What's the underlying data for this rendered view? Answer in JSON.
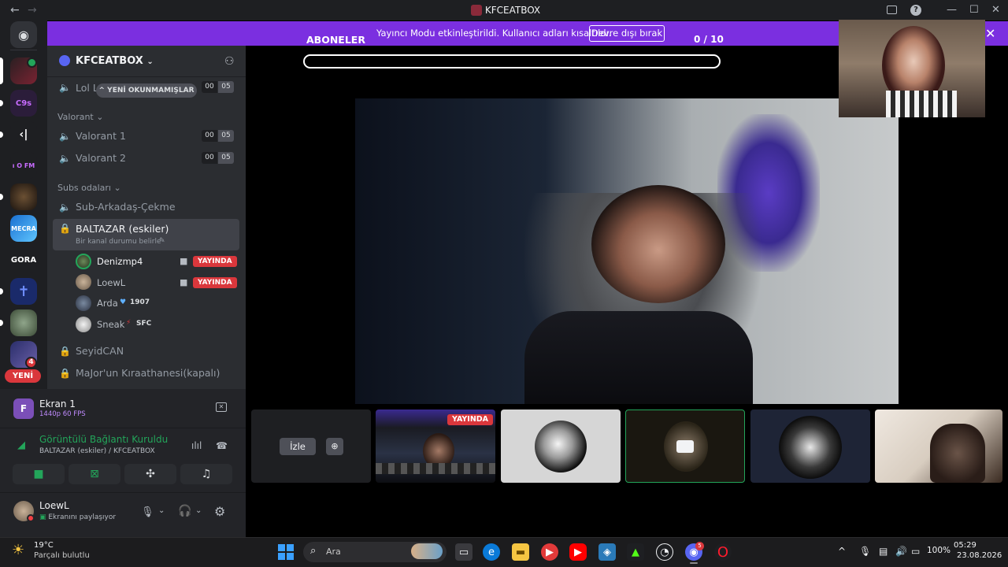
{
  "titlebar": {
    "title": "KFCEATBOX",
    "back": "←",
    "forward": "→",
    "inbox_icon": "inbox-icon",
    "help": "?",
    "minimize": "—",
    "maximize": "☐",
    "close": "✕"
  },
  "rail": {
    "servers": [
      {
        "name": "discord-home",
        "label": "◉"
      },
      {
        "name": "kfceatbox",
        "label": ""
      },
      {
        "name": "c9s",
        "label": "C9s"
      },
      {
        "name": "k-logo",
        "label": "‹|"
      },
      {
        "name": "ufm",
        "label": "ı O FM"
      },
      {
        "name": "dark-server",
        "label": ""
      },
      {
        "name": "mecra",
        "label": "MECRA"
      },
      {
        "name": "gora",
        "label": "GORA"
      },
      {
        "name": "cross-server",
        "label": "✝"
      },
      {
        "name": "green-server",
        "label": ""
      },
      {
        "name": "purple-server",
        "label": ""
      }
    ],
    "notification_count": "4",
    "yeni_label": "YENİ"
  },
  "streamer_bar": {
    "message": "Yayıncı Modu etkinleştirildi. Kullanıcı adları kısaltıldı.",
    "disable_button": "Devre dışı bırak",
    "close": "✕"
  },
  "sidebar": {
    "server_name": "KFCEATBOX",
    "unread_pill": "YENİ OKUNMAMIŞLAR",
    "top_channel": {
      "name": "Lol L",
      "count_a": "00",
      "count_b": "05"
    },
    "categories": [
      {
        "name": "Valorant",
        "channels": [
          {
            "name": "Valorant 1",
            "count_a": "00",
            "count_b": "05"
          },
          {
            "name": "Valorant 2",
            "count_a": "00",
            "count_b": "05"
          }
        ]
      },
      {
        "name": "Subs odaları",
        "channels": [
          {
            "name": "Sub-Arkadaş-Çekme"
          }
        ]
      }
    ],
    "active_channel": {
      "name": "BALTAZAR (eskiler)",
      "status": "Bir kanal durumu belirle"
    },
    "members": [
      {
        "name": "Denizmp4",
        "badge": "YAYINDA"
      },
      {
        "name": "LoewL",
        "badge": "YAYINDA"
      },
      {
        "name": "Arda",
        "tag": "1907"
      },
      {
        "name": "Sneak",
        "tag": "SFC"
      }
    ],
    "locked_channels": [
      "SeyidCAN",
      "MaJor'un Kıraathanesi(kapalı)"
    ]
  },
  "panel": {
    "stream": {
      "title": "Ekran 1",
      "quality": "1440p 60 FPS",
      "avatar_letter": "F"
    },
    "connection": {
      "title": "Görüntülü Bağlantı Kuruldu",
      "subtitle": "BALTAZAR (eskiler) / KFCEATBOX"
    },
    "user": {
      "name": "LoewL",
      "status": "Ekranını paylaşıyor"
    }
  },
  "main": {
    "aboneler": "ABONELER",
    "goal": "0 / 10",
    "goal_progress": 0,
    "tiles": [
      {
        "name": "izle-tile",
        "button": "İzle"
      },
      {
        "name": "stream-tile",
        "badge": "YAYINDA"
      },
      {
        "name": "avatar-tile-1"
      },
      {
        "name": "avatar-tile-2"
      },
      {
        "name": "avatar-tile-3"
      },
      {
        "name": "camera-tile"
      }
    ]
  },
  "taskbar": {
    "weather_temp": "19°C",
    "weather_desc": "Parçalı bulutlu",
    "search_placeholder": "Ara",
    "discord_badge": "5",
    "battery": "100%",
    "time": "05:29",
    "date": "23.08.2026"
  },
  "colors": {
    "blurple": "#5865f2",
    "streamer_purple": "#7b2fe0",
    "live_red": "#da373c",
    "connected_green": "#23a55a"
  }
}
